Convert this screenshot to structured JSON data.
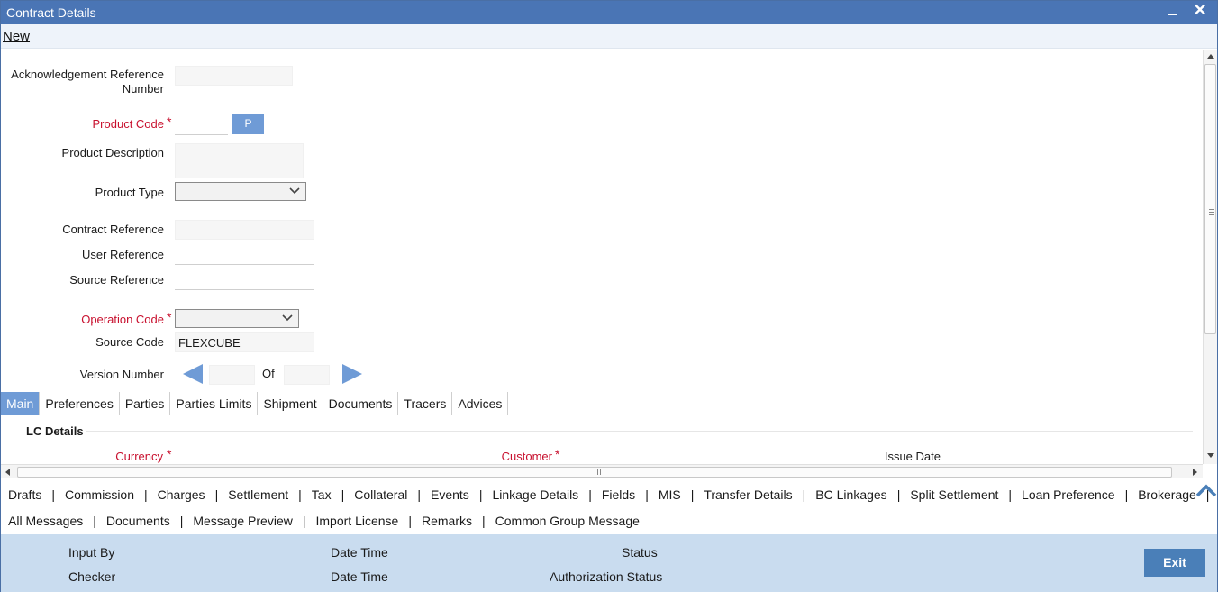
{
  "window": {
    "title": "Contract Details"
  },
  "menu": {
    "new_label": "New"
  },
  "form": {
    "ack_ref_label_line1": "Acknowledgement Reference",
    "ack_ref_label_line2": "Number",
    "ack_ref_value": "",
    "product_code_label": "Product Code",
    "product_code_value": "",
    "p_button_label": "P",
    "product_description_label": "Product Description",
    "product_description_value": "",
    "product_type_label": "Product Type",
    "product_type_value": "",
    "contract_reference_label": "Contract Reference",
    "contract_reference_value": "",
    "user_reference_label": "User Reference",
    "user_reference_value": "",
    "source_reference_label": "Source Reference",
    "source_reference_value": "",
    "operation_code_label": "Operation Code",
    "operation_code_value": "",
    "source_code_label": "Source Code",
    "source_code_value": "FLEXCUBE",
    "version_number_label": "Version Number",
    "version_current": "",
    "version_of_label": "Of",
    "version_total": "",
    "required_mark": "*"
  },
  "tabs": [
    {
      "label": "Main",
      "active": true
    },
    {
      "label": "Preferences"
    },
    {
      "label": "Parties"
    },
    {
      "label": "Parties Limits"
    },
    {
      "label": "Shipment"
    },
    {
      "label": "Documents"
    },
    {
      "label": "Tracers"
    },
    {
      "label": "Advices"
    }
  ],
  "lc_details": {
    "section_title": "LC Details",
    "currency_label": "Currency",
    "customer_label": "Customer",
    "issue_date_label": "Issue Date"
  },
  "links_row1": [
    "Drafts",
    "Commission",
    "Charges",
    "Settlement",
    "Tax",
    "Collateral",
    "Events",
    "Linkage Details",
    "Fields",
    "MIS",
    "Transfer Details",
    "BC Linkages",
    "Split Settlement",
    "Loan Preference",
    "Brokerage"
  ],
  "links_row2": [
    "All Messages",
    "Documents",
    "Message Preview",
    "Import License",
    "Remarks",
    "Common Group Message"
  ],
  "link_separator": "|",
  "footer": {
    "input_by_label": "Input By",
    "checker_label": "Checker",
    "date_time_label_1": "Date Time",
    "date_time_label_2": "Date Time",
    "status_label": "Status",
    "authorization_status_label": "Authorization Status",
    "exit_label": "Exit"
  },
  "colors": {
    "titlebar": "#4a75b5",
    "accent": "#6f9bd6",
    "required": "#c8102e",
    "footer_bg": "#c9dcef",
    "exit_button": "#4a7fb8"
  },
  "icons": {
    "minimize": "minimize-icon",
    "close": "close-icon",
    "version_prev": "arrow-left-icon",
    "version_next": "arrow-right-icon",
    "scroll_top": "chevron-up-icon"
  }
}
